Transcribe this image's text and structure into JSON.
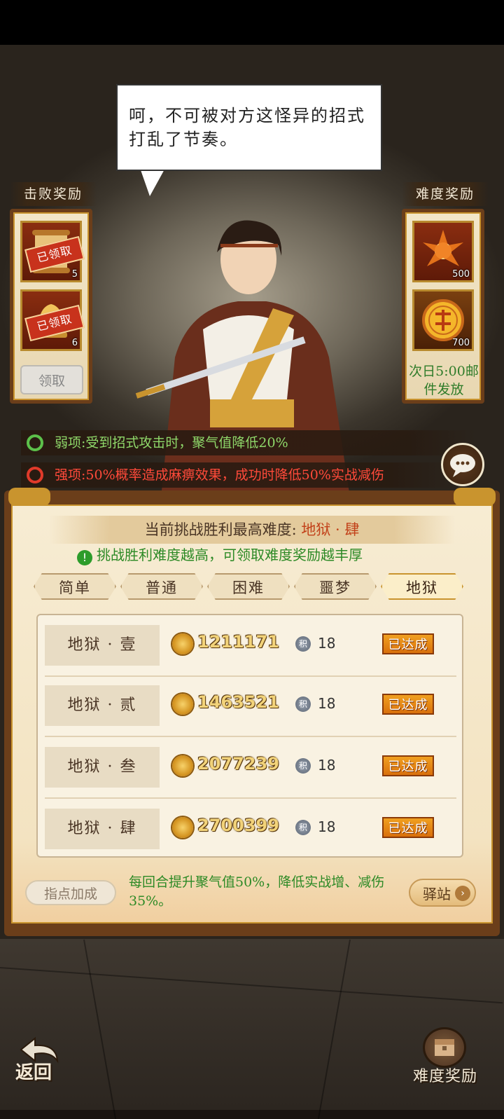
{
  "dialog": {
    "text": "呵，不可被对方这怪异的招式打乱了节奏。"
  },
  "defeat_rewards": {
    "title": "击败奖励",
    "items": [
      {
        "icon": "scroll-icon",
        "count": "5",
        "stamp": "已领取"
      },
      {
        "icon": "bell-icon",
        "count": "6",
        "stamp": "已领取"
      }
    ],
    "claim_label": "领取"
  },
  "difficulty_rewards": {
    "title": "难度奖励",
    "items": [
      {
        "icon": "flame-lotus-icon",
        "count": "500"
      },
      {
        "icon": "imperial-coin-icon",
        "count": "700"
      }
    ],
    "mail_note": "次日5:00邮件发放"
  },
  "traits": {
    "weakness": "弱项:受到招式攻击时，聚气值降低20%",
    "strength": "强项:50%概率造成麻痹效果，成功时降低50%实战减伤"
  },
  "panel": {
    "header_prefix": "当前挑战胜利最高难度:",
    "header_value": "地狱 · 肆",
    "tip": "挑战胜利难度越高，可领取难度奖励越丰厚",
    "tabs": [
      "简单",
      "普通",
      "困难",
      "噩梦",
      "地狱"
    ],
    "active_tab": "地狱",
    "rows": [
      {
        "name": "地狱 · 壹",
        "power": "1211171",
        "points": "18",
        "status": "已达成"
      },
      {
        "name": "地狱 · 贰",
        "power": "1463521",
        "points": "18",
        "status": "已达成"
      },
      {
        "name": "地狱 · 叁",
        "power": "2077239",
        "points": "18",
        "status": "已达成"
      },
      {
        "name": "地狱 · 肆",
        "power": "2700399",
        "points": "18",
        "status": "已达成"
      }
    ],
    "points_icon_text": "积",
    "bonus_label": "指点加成",
    "bonus_text": "每回合提升聚气值50%，降低实战增、减伤35%。",
    "station_label": "驿站"
  },
  "footer": {
    "back_label": "返回",
    "difficulty_reward_label": "难度奖励"
  },
  "colors": {
    "accent_gold": "#c9942e",
    "frame_brown": "#6b3e1a",
    "weakness_green": "#8fd86a",
    "strength_red": "#ff4a3a",
    "done_orange": "#e8860f"
  }
}
